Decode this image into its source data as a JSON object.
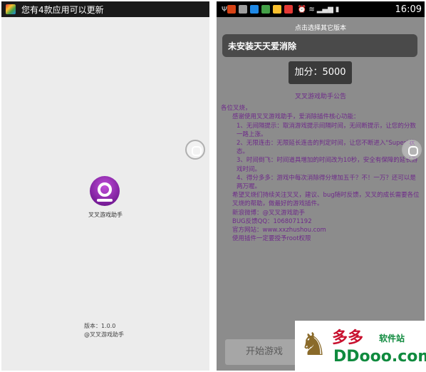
{
  "left_screen": {
    "status_text": "您有4款应用可以更新",
    "logo_caption": "叉叉游戏助手",
    "version": "版本：1.0.0",
    "copyright": "@叉叉游戏助手"
  },
  "right_screen": {
    "time": "16:09",
    "hint": "点击选择其它版本",
    "game_status": "未安装天天爱消除",
    "score_button": "加分：5000",
    "notice_title": "叉叉游戏助手公告",
    "notice_lines": [
      "各位叉烧，",
      "感谢使用叉叉游戏助手，爱消除插件核心功能：",
      "1、无间隔提示：取消游戏提示间隔时间，无间断提示，让您的分数一路上涨。",
      "2、无限连击：无限延长连击的判定时间，让您不断进入\"Super\"状态。",
      "3、时间倒飞：时间道具增加的时间改为10秒，安全有保障的延长游戏时间。",
      "4、得分多多：游戏中每次消除得分增加五千？不！一万？还可以是两万喔。",
      "希望叉烧们持续关注叉叉，建议、bug随时反馈，叉叉的成长需要各位叉烧的帮助，做最好的游戏插件。",
      "新浪微博：@叉叉游戏助手",
      "BUG反馈QQ：1068071192",
      "官方网站：www.xxzhushou.com",
      "使用插件一定要授予root权限"
    ],
    "start_button": "开始游戏"
  },
  "watermark": {
    "cn": "多多",
    "cn2": "软件站",
    "domain": "DDooo.com"
  },
  "colors": {
    "notice_text": "#6e2a8a",
    "logo": "#7a1e9a",
    "watermark_red": "#c8102e",
    "watermark_green": "#0f8a3e"
  },
  "icons": [
    "app-update-icon",
    "usb-icon",
    "notification-app-icons",
    "alarm-icon",
    "wifi-icon",
    "signal-icon",
    "battery-icon",
    "floating-assist-icon",
    "horse-logo-icon"
  ]
}
